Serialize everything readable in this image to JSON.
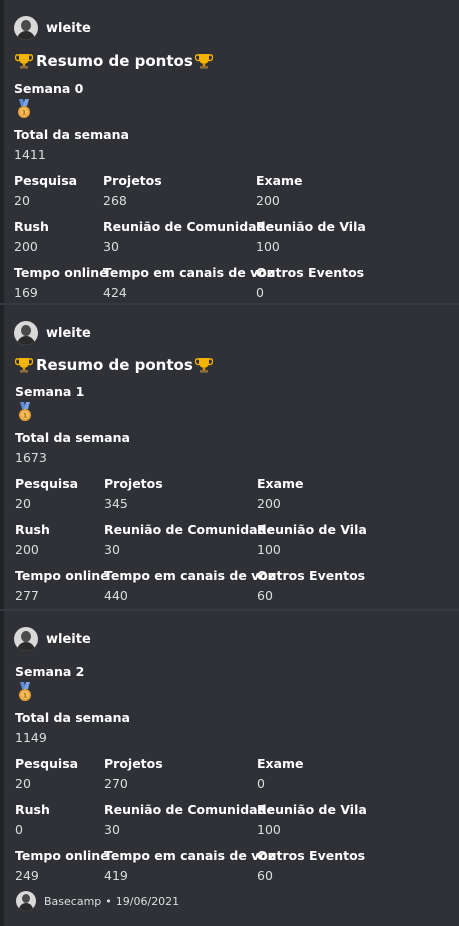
{
  "embeds": [
    {
      "author": "wleite",
      "title": "Resumo de pontos",
      "week": "Semana 0",
      "total_label": "Total da semana",
      "total": "1411",
      "fields": [
        {
          "name": "Pesquisa",
          "value": "20"
        },
        {
          "name": "Projetos",
          "value": "268"
        },
        {
          "name": "Exame",
          "value": "200"
        },
        {
          "name": "Rush",
          "value": "200"
        },
        {
          "name": "Reunião de Comunidade",
          "value": "30"
        },
        {
          "name": "Reunião de Vila",
          "value": "100"
        },
        {
          "name": "Tempo online",
          "value": "169"
        },
        {
          "name": "Tempo em canais de voz",
          "value": "424"
        },
        {
          "name": "Outros Eventos",
          "value": "0"
        }
      ]
    },
    {
      "author": "wleite",
      "title": "Resumo de pontos",
      "week": "Semana 1",
      "total_label": "Total da semana",
      "total": "1673",
      "fields": [
        {
          "name": "Pesquisa",
          "value": "20"
        },
        {
          "name": "Projetos",
          "value": "345"
        },
        {
          "name": "Exame",
          "value": "200"
        },
        {
          "name": "Rush",
          "value": "200"
        },
        {
          "name": "Reunião de Comunidade",
          "value": "30"
        },
        {
          "name": "Reunião de Vila",
          "value": "100"
        },
        {
          "name": "Tempo online",
          "value": "277"
        },
        {
          "name": "Tempo em canais de voz",
          "value": "440"
        },
        {
          "name": "Outros Eventos",
          "value": "60"
        }
      ]
    },
    {
      "author": "wleite",
      "week": "Semana 2",
      "total_label": "Total da semana",
      "total": "1149",
      "fields": [
        {
          "name": "Pesquisa",
          "value": "20"
        },
        {
          "name": "Projetos",
          "value": "270"
        },
        {
          "name": "Exame",
          "value": "0"
        },
        {
          "name": "Rush",
          "value": "0"
        },
        {
          "name": "Reunião de Comunidade",
          "value": "30"
        },
        {
          "name": "Reunião de Vila",
          "value": "100"
        },
        {
          "name": "Tempo online",
          "value": "249"
        },
        {
          "name": "Tempo em canais de voz",
          "value": "419"
        },
        {
          "name": "Outros Eventos",
          "value": "60"
        }
      ],
      "footer": {
        "text": "Basecamp",
        "separator": "•",
        "date": "19/06/2021"
      }
    }
  ],
  "icons": {
    "title": "trophy-icon",
    "medal": "medal-icon",
    "avatar": "avatar-icon"
  },
  "colors": {
    "background": "#36393f",
    "embed": "#2f3136",
    "accent_border": "#202225",
    "trophy": "#f4b400",
    "medal": "#e8a33d"
  }
}
